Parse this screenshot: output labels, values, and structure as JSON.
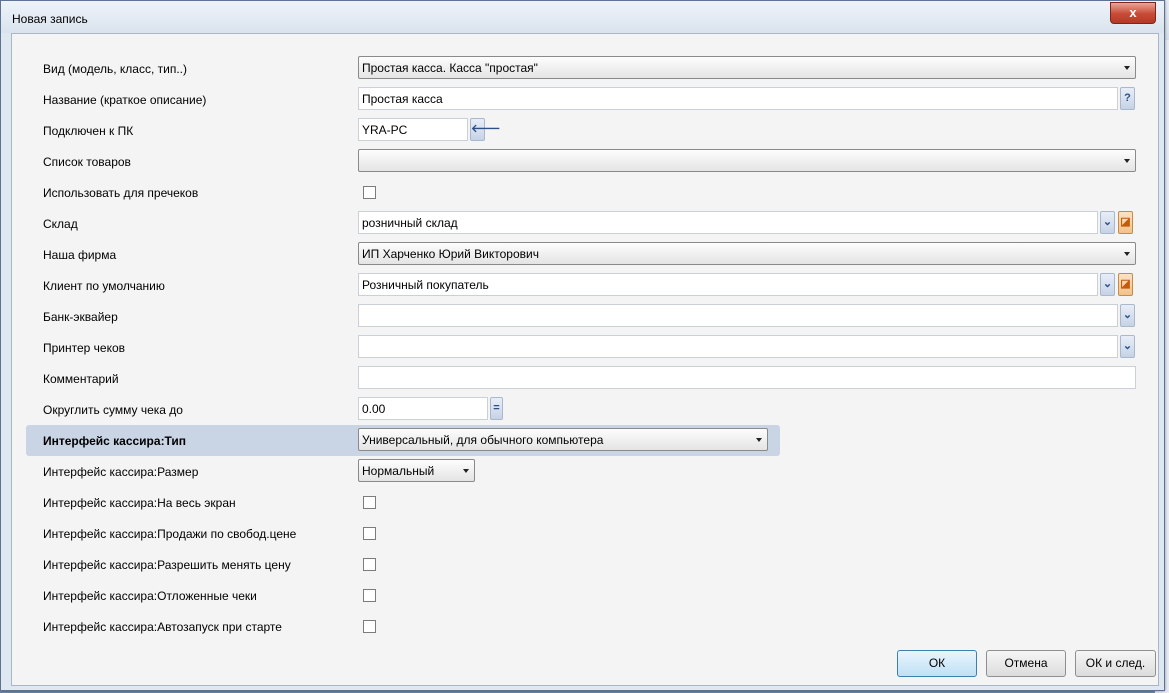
{
  "window": {
    "title": "Новая запись",
    "close_symbol": "x"
  },
  "fields": {
    "vid": {
      "label": "Вид (модель, класс, тип..)",
      "value": "Простая касса. Касса \"простая\""
    },
    "nazvanie": {
      "label": "Название (краткое описание)",
      "value": "Простая касса",
      "help": "?"
    },
    "pk": {
      "label": "Подключен к ПК",
      "value": "YRA-PC",
      "button": "🡐"
    },
    "tovary": {
      "label": "Список товаров",
      "value": ""
    },
    "precheki": {
      "label": "Использовать для пречеков",
      "checked": false
    },
    "sklad": {
      "label": "Склад",
      "value": "розничный склад"
    },
    "firma": {
      "label": "Наша фирма",
      "value": "ИП Харченко Юрий Викторович"
    },
    "klient": {
      "label": "Клиент по умолчанию",
      "value": "Розничный покупатель"
    },
    "bank": {
      "label": "Банк-эквайер",
      "value": ""
    },
    "printer": {
      "label": "Принтер чеков",
      "value": ""
    },
    "komment": {
      "label": "Комментарий",
      "value": ""
    },
    "okrugl": {
      "label": "Округлить сумму чека до",
      "value": "0.00",
      "button": "="
    },
    "ui_tip": {
      "label": "Интерфейс кассира:Тип",
      "value": "Универсальный, для обычного компьютера"
    },
    "ui_size": {
      "label": "Интерфейс кассира:Размер",
      "value": "Нормальный"
    },
    "ui_full": {
      "label": "Интерфейс кассира:На весь экран",
      "checked": false
    },
    "ui_free": {
      "label": "Интерфейс кассира:Продажи по свобод.цене",
      "checked": false
    },
    "ui_price": {
      "label": "Интерфейс кассира:Разрешить менять цену",
      "checked": false
    },
    "ui_defer": {
      "label": "Интерфейс кассира:Отложенные чеки",
      "checked": false
    },
    "ui_auto": {
      "label": "Интерфейс кассира:Автозапуск при старте",
      "checked": false
    }
  },
  "buttons": {
    "ok": "ОК",
    "cancel": "Отмена",
    "ok_next": "ОК и след."
  },
  "icons": {
    "lookup": "chevron-down-icon",
    "open": "open-icon",
    "back": "arrow-left-icon"
  }
}
